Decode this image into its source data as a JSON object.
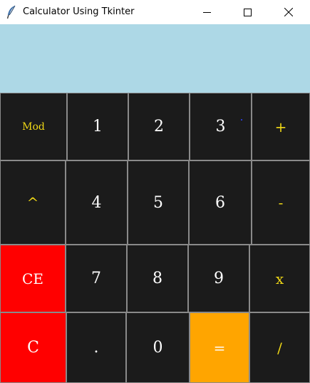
{
  "window": {
    "title": "Calculator Using Tkinter",
    "app_icon": "feather-icon",
    "controls": [
      "minimize-icon",
      "maximize-icon",
      "close-icon"
    ]
  },
  "display": {
    "value": "",
    "background": "#add8e6"
  },
  "keys": {
    "mod": "Mod",
    "k1": "1",
    "k2": "2",
    "k3": "3",
    "plus": "+",
    "pow": "^",
    "k4": "4",
    "k5": "5",
    "k6": "6",
    "minus": "-",
    "ce": "CE",
    "k7": "7",
    "k8": "8",
    "k9": "9",
    "times": "x",
    "clear": "C",
    "dot": ".",
    "k0": "0",
    "equals": "=",
    "divide": "/"
  },
  "colors": {
    "key_background": "#1b1b1b",
    "operator_text": "#f0d816",
    "clear_background": "#ff0000",
    "equals_background": "#ffa500"
  }
}
